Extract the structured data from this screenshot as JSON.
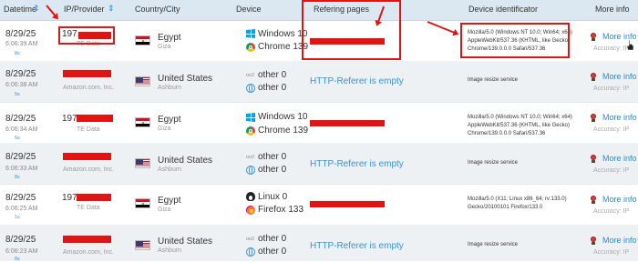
{
  "header": {
    "datetime": "Datetime",
    "ip_provider": "IP/Provider",
    "country_city": "Country/City",
    "device": "Device",
    "refering_pages": "Refering pages",
    "device_identificator": "Device identificator",
    "more_info": "More info"
  },
  "labels": {
    "more_info_link": "More info",
    "accuracy": "Accuracy: IP"
  },
  "rows": [
    {
      "date": "8/29/25",
      "time": "6:06:39 AM",
      "ago": "8s",
      "ip": "197.",
      "isp": "TE Data",
      "country": "Egypt",
      "city": "Giza",
      "device1": "Windows 10",
      "device2": "Chrome 139",
      "referer": "",
      "ua": "Mozilla/5.0 (Windows NT 10.0; Win64; x64) AppleWebKit/537.36 (KHTML, like Gecko) Chrome/139.0.0.0 Safari/537.36"
    },
    {
      "date": "8/29/25",
      "time": "6:06:38 AM",
      "ago": "5s",
      "ip": "",
      "isp": "Amazon.com, Inc.",
      "country": "United States",
      "city": "Ashburn",
      "device1_small": "oo2",
      "device1": "other 0",
      "device2": "other 0",
      "referer": "HTTP-Referer is empty",
      "ua": "Image resize service"
    },
    {
      "date": "8/29/25",
      "time": "6:06:34 AM",
      "ago": "5s",
      "ip": "197.",
      "isp": "TE Data",
      "country": "Egypt",
      "city": "Giza",
      "device1": "Windows 10",
      "device2": "Chrome 139",
      "referer": "",
      "ua": "Mozilla/5.0 (Windows NT 10.0; Win64; x64) AppleWebKit/537.36 (KHTML, like Gecko) Chrome/139.0.0.0 Safari/537.36"
    },
    {
      "date": "8/29/25",
      "time": "6:06:33 AM",
      "ago": "8s",
      "ip": "",
      "isp": "Amazon.com, Inc.",
      "country": "United States",
      "city": "Ashburn",
      "device1_small": "oo2",
      "device1": "other 0",
      "device2": "other 0",
      "referer": "HTTP-Referer is empty",
      "ua": "Image resize service"
    },
    {
      "date": "8/29/25",
      "time": "6:06:25 AM",
      "ago": "1s",
      "ip": "197.",
      "isp": "TE Data",
      "country": "Egypt",
      "city": "Giza",
      "device1": "Linux 0",
      "device2": "Firefox 133",
      "referer": "",
      "ua": "Mozilla/5.0 (X11; Linux x86_64; rv:133.0) Gecko/20100101 Firefox/133.0"
    },
    {
      "date": "8/29/25",
      "time": "6:06:23 AM",
      "ago": "8s",
      "ip": "",
      "isp": "Amazon.com, Inc.",
      "country": "United States",
      "city": "Ashburn",
      "device1_small": "oo2",
      "device1": "other 0",
      "device2": "other 0",
      "referer": "HTTP-Referer is empty",
      "ua": "Image resize service"
    }
  ],
  "colors": {
    "annotation": "#e11414",
    "link": "#2b8ad1",
    "header_bg": "#dce8f1"
  }
}
